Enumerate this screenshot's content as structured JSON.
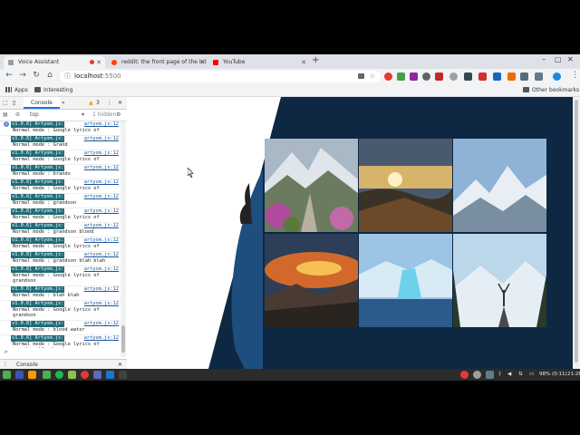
{
  "browser": {
    "tabs": [
      {
        "title": "Voice Assistant",
        "active": true,
        "recording": true,
        "icon_color": "#9e9e9e"
      },
      {
        "title": "reddit: the front page of the int",
        "active": false,
        "icon_color": "#ff4500"
      },
      {
        "title": "YouTube",
        "active": false,
        "icon_color": "#ff0000"
      }
    ],
    "new_tab_icon": "plus-icon",
    "address": {
      "host": "localhost",
      "port": ":5500"
    },
    "bookmarks": {
      "apps": "Apps",
      "folder": "Interesting",
      "other": "Other bookmarks"
    }
  },
  "devtools": {
    "panel_tab": "Console",
    "more": "»",
    "warnings": "3",
    "context": "top",
    "hidden": "1 hidden",
    "first_count": "2",
    "logs": [
      {
        "badge": "v1.0.6] Artyom.js:",
        "source": "artyom.js:12",
        "message": "Normal mode :  Google lyrics of"
      },
      {
        "badge": "v1.0.6] Artyom.js:",
        "source": "artyom.js:12",
        "message": "Normal mode :  Grand"
      },
      {
        "badge": "v1.0.6] Artyom.js:",
        "source": "artyom.js:12",
        "message": "Normal mode :  Google lyrics of"
      },
      {
        "badge": "v1.0.6] Artyom.js:",
        "source": "artyom.js:12",
        "message": "Normal mode :  brands"
      },
      {
        "badge": "v1.0.6] Artyom.js:",
        "source": "artyom.js:12",
        "message": "Normal mode :  Google lyrics of"
      },
      {
        "badge": "v1.0.6] Artyom.js:",
        "source": "artyom.js:12",
        "message": "Normal mode :  grandson"
      },
      {
        "badge": "v1.0.6] Artyom.js:",
        "source": "artyom.js:12",
        "message": "Normal mode :  Google lyrics of"
      },
      {
        "badge": "v1.0.6] Artyom.js:",
        "source": "artyom.js:12",
        "message": "Normal mode :  grandson blood"
      },
      {
        "badge": "v1.0.6] Artyom.js:",
        "source": "artyom.js:12",
        "message": "Normal mode :  Google lyrics of"
      },
      {
        "badge": "v1.0.6] Artyom.js:",
        "source": "artyom.js:12",
        "message": "Normal mode :  grandson blah blah"
      },
      {
        "badge": "v1.0.6] Artyom.js:",
        "source": "artyom.js:12",
        "message": "Normal mode :  Google lyrics of grandson"
      },
      {
        "badge": "v1.0.6] Artyom.js:",
        "source": "artyom.js:12",
        "message": "Normal mode :  blah blah"
      },
      {
        "badge": "v1.0.6] Artyom.js:",
        "source": "artyom.js:12",
        "message": "Normal mode :  Google lyrics of grandson"
      },
      {
        "badge": "v1.0.6] Artyom.js:",
        "source": "artyom.js:12",
        "message": "Normal mode :  blood water"
      },
      {
        "badge": "v1.0.6] Artyom.js:",
        "source": "artyom.js:12",
        "message": "Normal mode :  Google lyrics of grandson blood water"
      }
    ],
    "prompt": ">",
    "drawer": "Console"
  },
  "page": {
    "background": "#0e2742",
    "images": [
      {
        "name": "mountain-path-image"
      },
      {
        "name": "sunset-valley-image"
      },
      {
        "name": "snowy-peaks-image"
      },
      {
        "name": "fiery-sky-image"
      },
      {
        "name": "iceberg-image"
      },
      {
        "name": "hiker-image"
      }
    ]
  },
  "taskbar": {
    "battery": "98% (0:11)",
    "time": "21:26"
  }
}
